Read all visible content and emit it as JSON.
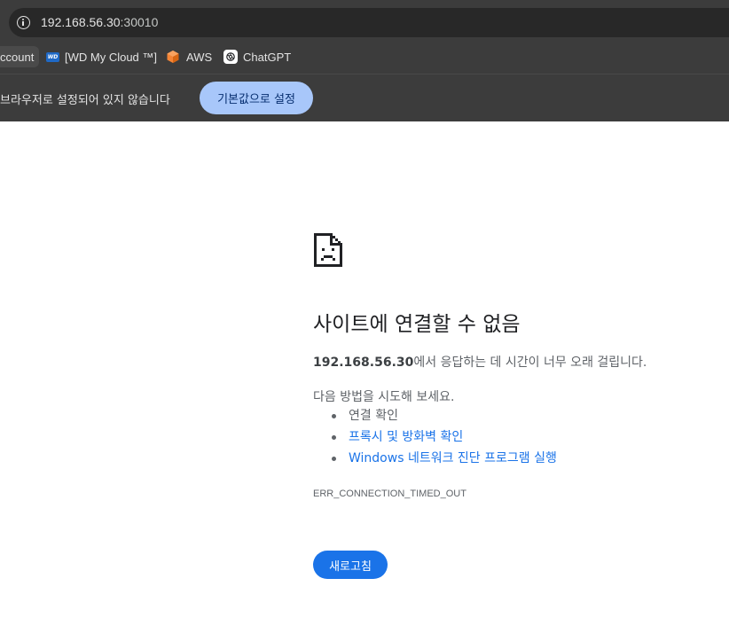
{
  "omnibox": {
    "host": "192.168.56.30",
    "port": ":30010",
    "icon": "info-icon"
  },
  "bookmarks": [
    {
      "label": "ccount",
      "icon": ""
    },
    {
      "label": "[WD My Cloud ™]",
      "icon": "wd-logo-icon"
    },
    {
      "label": "AWS",
      "icon": "aws-logo-icon"
    },
    {
      "label": "ChatGPT",
      "icon": "chatgpt-logo-icon"
    }
  ],
  "infobar": {
    "message": "브라우저로 설정되어 있지 않습니다",
    "button_label": "기본값으로 설정"
  },
  "error": {
    "title": "사이트에 연결할 수 없음",
    "host": "192.168.56.30",
    "desc_suffix": "에서 응답하는 데 시간이 너무 오래 걸립니다.",
    "suggest_intro": "다음 방법을 시도해 보세요.",
    "suggestions": [
      {
        "label": "연결 확인",
        "link": false
      },
      {
        "label": "프록시 및 방화벽 확인",
        "link": true
      },
      {
        "label": "Windows 네트워크 진단 프로그램 실행",
        "link": true
      }
    ],
    "code": "ERR_CONNECTION_TIMED_OUT",
    "reload_label": "새로고침"
  },
  "colors": {
    "chrome_bg": "#3c3c3c",
    "omnibox_bg": "#282828",
    "infobar_button": "#a8c7fa",
    "link": "#1a73e8",
    "reload_button": "#1a73e8"
  }
}
